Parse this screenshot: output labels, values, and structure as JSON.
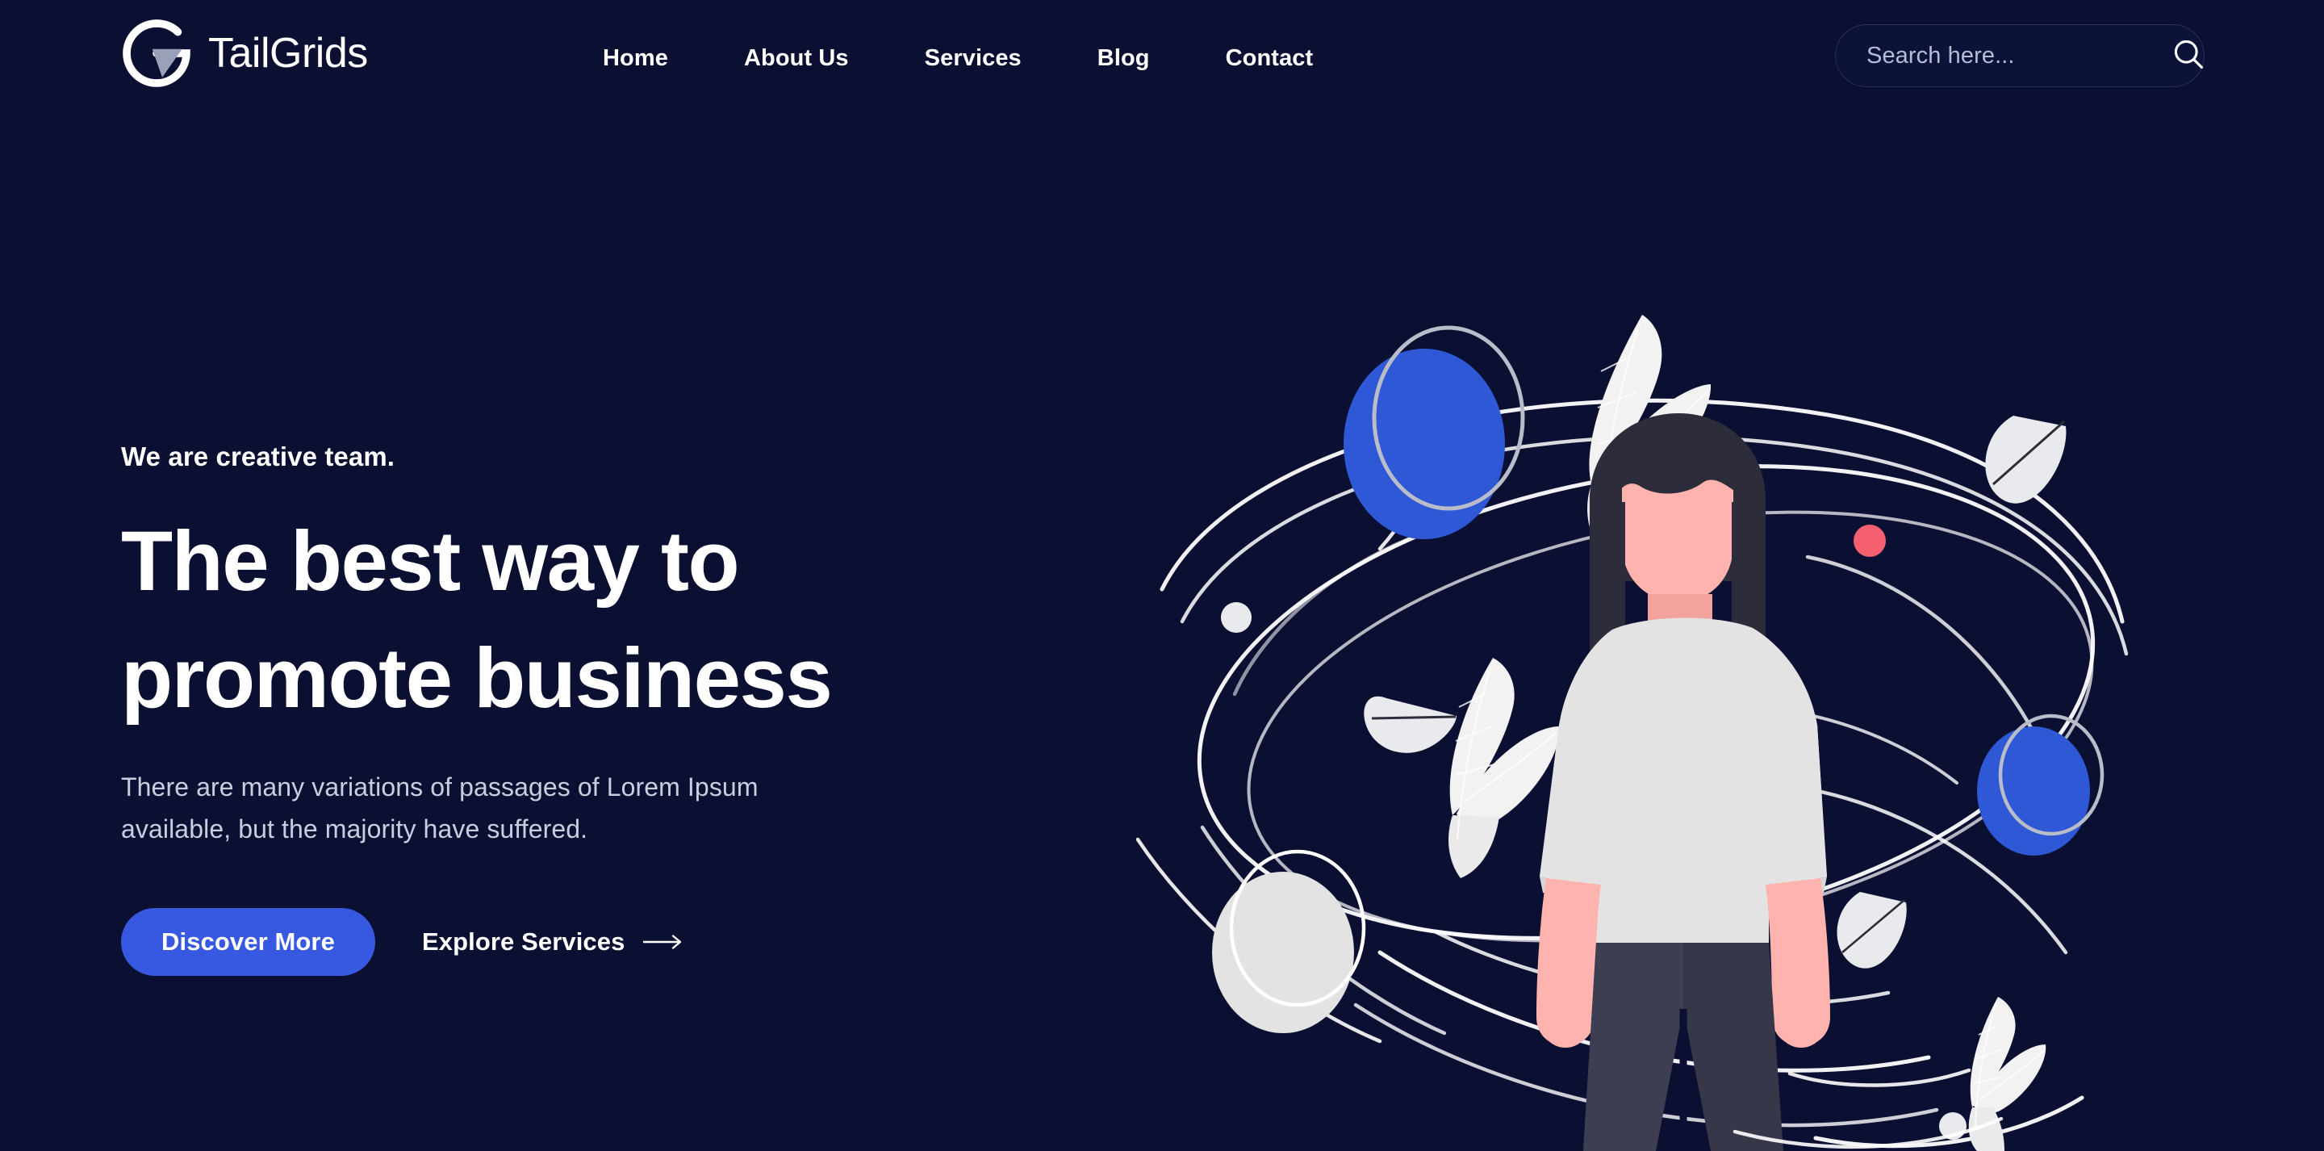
{
  "brand": {
    "name": "TailGrids",
    "logo_icon": "g-circle-logo-icon",
    "logo_ring_color": "#FFFFFF",
    "logo_wedge_color": "#9AA0B8"
  },
  "nav": {
    "items": [
      {
        "label": "Home"
      },
      {
        "label": "About Us"
      },
      {
        "label": "Services"
      },
      {
        "label": "Blog"
      },
      {
        "label": "Contact"
      }
    ]
  },
  "search": {
    "placeholder": "Search here...",
    "value": "",
    "icon": "search-icon"
  },
  "hero": {
    "eyebrow": "We are creative team.",
    "headline_line1": "The best way to",
    "headline_line2": "promote business",
    "subtext": "There are many variations of passages of Lorem Ipsum available, but the majority have suffered.",
    "primary_button": "Discover More",
    "secondary_link": "Explore Services",
    "secondary_link_icon": "arrow-right-icon"
  },
  "colors": {
    "background": "#0B1033",
    "accent_blue": "#3758E0",
    "planet_blue": "#2E58D5",
    "accent_pink": "#F4606F",
    "skin_pink": "#FFB3AE",
    "hair_dark": "#2C2C3B",
    "shirt_light": "#E3E3E3",
    "pants_dark": "#37374A",
    "line_white": "#FFFFFF",
    "ring_gray": "#B9BCC9",
    "text_muted": "#C9CEDF",
    "search_border": "#2A3050"
  },
  "illustration": {
    "name": "woman-with-orbiting-planets-and-leaves",
    "elements": [
      "blue-planet-top-left",
      "blue-planet-right",
      "white-planet-left",
      "pink-dot",
      "white-dot-left",
      "white-dot-bottom-right",
      "leaf-small-left",
      "leaf-small-right",
      "leaf-small-lower-right",
      "bird-leaf-top",
      "bird-leaf-left",
      "bird-leaf-bottom-right",
      "orbit-lines",
      "woman-figure"
    ]
  }
}
